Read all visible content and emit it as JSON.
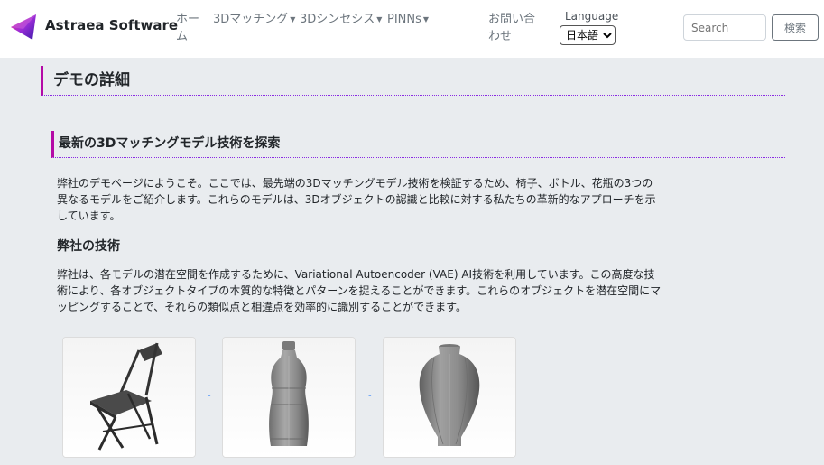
{
  "brand": {
    "name": "Astraea Software",
    "logo_caption": "Astraea"
  },
  "nav": {
    "home": "ホーム",
    "matching": "3Dマッチング",
    "synthesis": "3Dシンセシス",
    "pinns": "PINNs",
    "contact": "お問い合わせ"
  },
  "language": {
    "label": "Language",
    "selected": "日本語"
  },
  "search": {
    "placeholder": "Search",
    "button": "検索"
  },
  "page": {
    "title": "デモの詳細",
    "section_title": "最新の3Dマッチングモデル技術を探索",
    "intro": "弊社のデモページにようこそ。ここでは、最先端の3Dマッチングモデル技術を検証するため、椅子、ボトル、花瓶の3つの異なるモデルをご紹介します。これらのモデルは、3Dオブジェクトの認識と比較に対する私たちの革新的なアプローチを示しています。",
    "tech_heading": "弊社の技術",
    "tech_body": "弊社は、各モデルの潜在空間を作成するために、Variational Autoencoder (VAE) AI技術を利用しています。この高度な技術により、各オブジェクトタイプの本質的な特徴とパターンを捉えることができます。これらのオブジェクトを潜在空間にマッピングすることで、それらの類似点と相違点を効率的に識別することができます。"
  },
  "models": {
    "separator": "-"
  },
  "colors": {
    "accent": "#b40aa6",
    "divider": "#8a2be2",
    "background": "#e9ecef"
  }
}
